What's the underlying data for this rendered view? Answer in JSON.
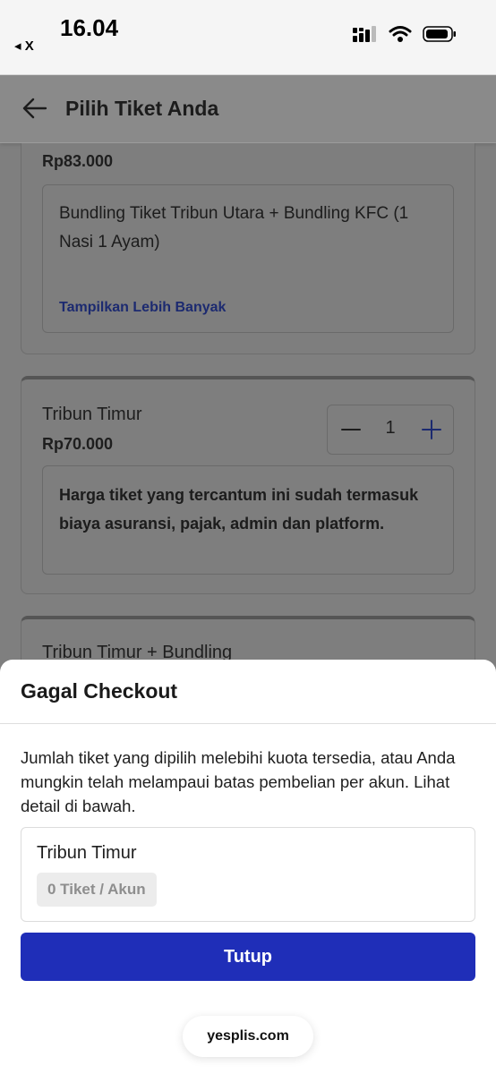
{
  "status_bar": {
    "time": "16.04",
    "back_label": "◂ X",
    "icons": [
      "signal-icon",
      "wifi-icon",
      "battery-icon"
    ]
  },
  "header": {
    "title": "Pilih Tiket Anda",
    "back_icon": "arrow-left-icon"
  },
  "tickets": [
    {
      "name": "",
      "price": "Rp83.000",
      "description": "Bundling Tiket Tribun Utara + Bundling KFC (1 Nasi 1 Ayam)",
      "show_more": "Tampilkan Lebih Banyak"
    },
    {
      "name": "Tribun Timur",
      "price": "Rp70.000",
      "description": "Harga tiket yang tercantum ini sudah termasuk biaya asuransi, pajak, admin dan platform.",
      "quantity": "1"
    },
    {
      "name": "Tribun Timur + Bundling"
    }
  ],
  "dialog": {
    "title": "Gagal Checkout",
    "message": "Jumlah tiket yang dipilih melebihi kuota tersedia, atau Anda mungkin telah melampaui batas pembelian per akun. Lihat detail di bawah.",
    "quota_item": {
      "name": "Tribun Timur",
      "limit": "0 Tiket / Akun"
    },
    "close_label": "Tutup"
  },
  "browser": {
    "domain": "yesplis.com"
  },
  "colors": {
    "primary": "#1f2eb8",
    "link": "#1c2a70",
    "overlay": "#7f7f7f"
  }
}
